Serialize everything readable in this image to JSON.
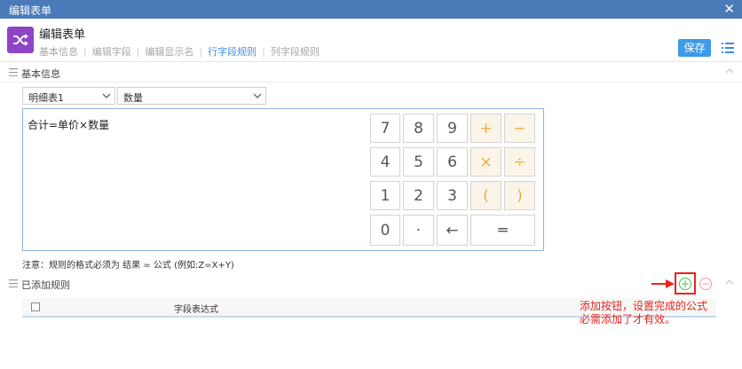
{
  "window": {
    "title": "编辑表单",
    "close_icon": "✕"
  },
  "header": {
    "app_icon": "shuffle-icon",
    "form_title": "编辑表单",
    "tabs": [
      {
        "label": "基本信息",
        "active": false
      },
      {
        "label": "编辑字段",
        "active": false
      },
      {
        "label": "编辑显示名",
        "active": false
      },
      {
        "label": "行字段规则",
        "active": true
      },
      {
        "label": "列字段规则",
        "active": false
      }
    ],
    "save_label": "保存",
    "menu_icon": "list-menu-icon"
  },
  "basic_section": {
    "title": "基本信息",
    "table_select": "明细表1",
    "field_select": "数量"
  },
  "editor": {
    "formula": "合计=单价×数量",
    "keys": {
      "k7": "7",
      "k8": "8",
      "k9": "9",
      "plus": "+",
      "minus": "−",
      "k4": "4",
      "k5": "5",
      "k6": "6",
      "times": "×",
      "divide": "÷",
      "k1": "1",
      "k2": "2",
      "k3": "3",
      "lparen": "(",
      "rparen": ")",
      "k0": "0",
      "dot": "·",
      "back": "←",
      "equals": "═"
    }
  },
  "note": "注意：规则的格式必须为 结果 = 公式 (例如:Z=X+Y)",
  "rules_section": {
    "title": "已添加规则",
    "add_icon": "+",
    "remove_icon": "−",
    "column_header": "字段表达式"
  },
  "annotation": {
    "line1": "添加按钮，设置完成的公式",
    "line2": "必需添加了才有效。"
  },
  "colors": {
    "titlebar": "#4a7ab8",
    "accent": "#3d9be9",
    "operator": "#f0a93e",
    "highlight": "#e8251c",
    "app_icon": "#8e44c4"
  }
}
